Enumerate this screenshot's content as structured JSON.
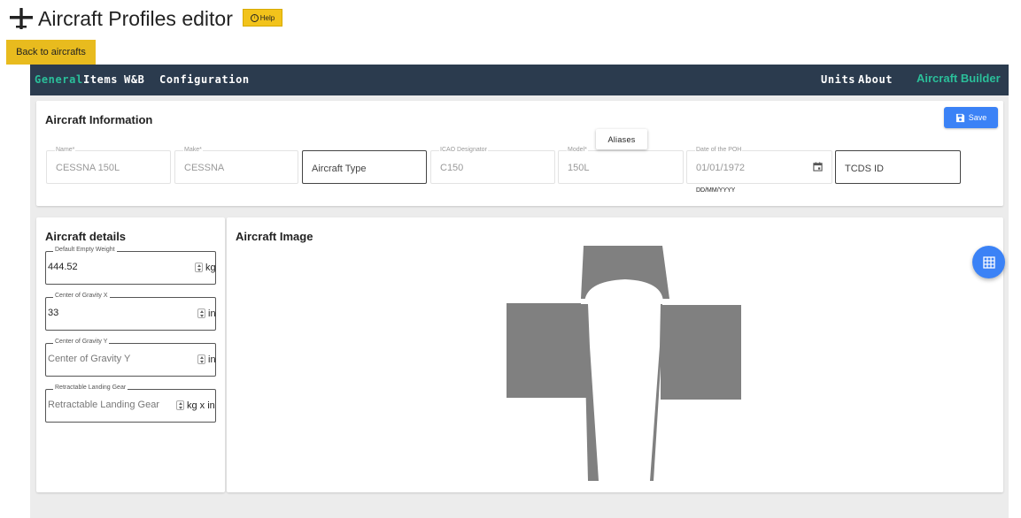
{
  "header": {
    "title": "Aircraft Profiles editor",
    "help_label": "Help",
    "back_label": "Back to aircrafts"
  },
  "nav": {
    "items": [
      {
        "label": "General",
        "active": true
      },
      {
        "label": "Items",
        "active": false
      },
      {
        "label": "W&B",
        "active": false
      },
      {
        "label": "Configuration",
        "active": false
      }
    ],
    "right_items": [
      {
        "label": "Units"
      },
      {
        "label": "About"
      }
    ],
    "brand": "Aircraft Builder"
  },
  "aircraft_info": {
    "title": "Aircraft Information",
    "save_label": "Save",
    "aliases_tooltip": "Aliases",
    "fields": [
      {
        "label": "Name*",
        "value": "CESSNA 150L"
      },
      {
        "label": "Make*",
        "value": "CESSNA"
      },
      {
        "label": "",
        "value": "Aircraft Type"
      },
      {
        "label": "ICAO Designator",
        "value": "C150"
      },
      {
        "label": "Model*",
        "value": "150L"
      },
      {
        "label": "Date of the POH",
        "value": "01/01/1972"
      },
      {
        "label": "",
        "value": "TCDS ID"
      }
    ],
    "date_format_hint": "DD/MM/YYYY"
  },
  "aircraft_details": {
    "title": "Aircraft details",
    "fields": [
      {
        "label": "Default Empty Weight",
        "value": "444.52",
        "unit": "kg"
      },
      {
        "label": "Center of Gravity X",
        "value": "33",
        "unit": "in"
      },
      {
        "label": "Center of Gravity Y",
        "placeholder": "Center of Gravity Y",
        "unit": "in"
      },
      {
        "label": "Retractable Landing Gear",
        "placeholder": "Retractable Landing Gear",
        "unit": "kg x in"
      }
    ]
  },
  "aircraft_image": {
    "title": "Aircraft Image"
  },
  "colors": {
    "navbar": "#2b3b4e",
    "accent_green": "#2bbf9a",
    "primary_blue": "#3b82f6",
    "help_yellow": "#f2c31b",
    "silhouette_gray": "#808080"
  }
}
